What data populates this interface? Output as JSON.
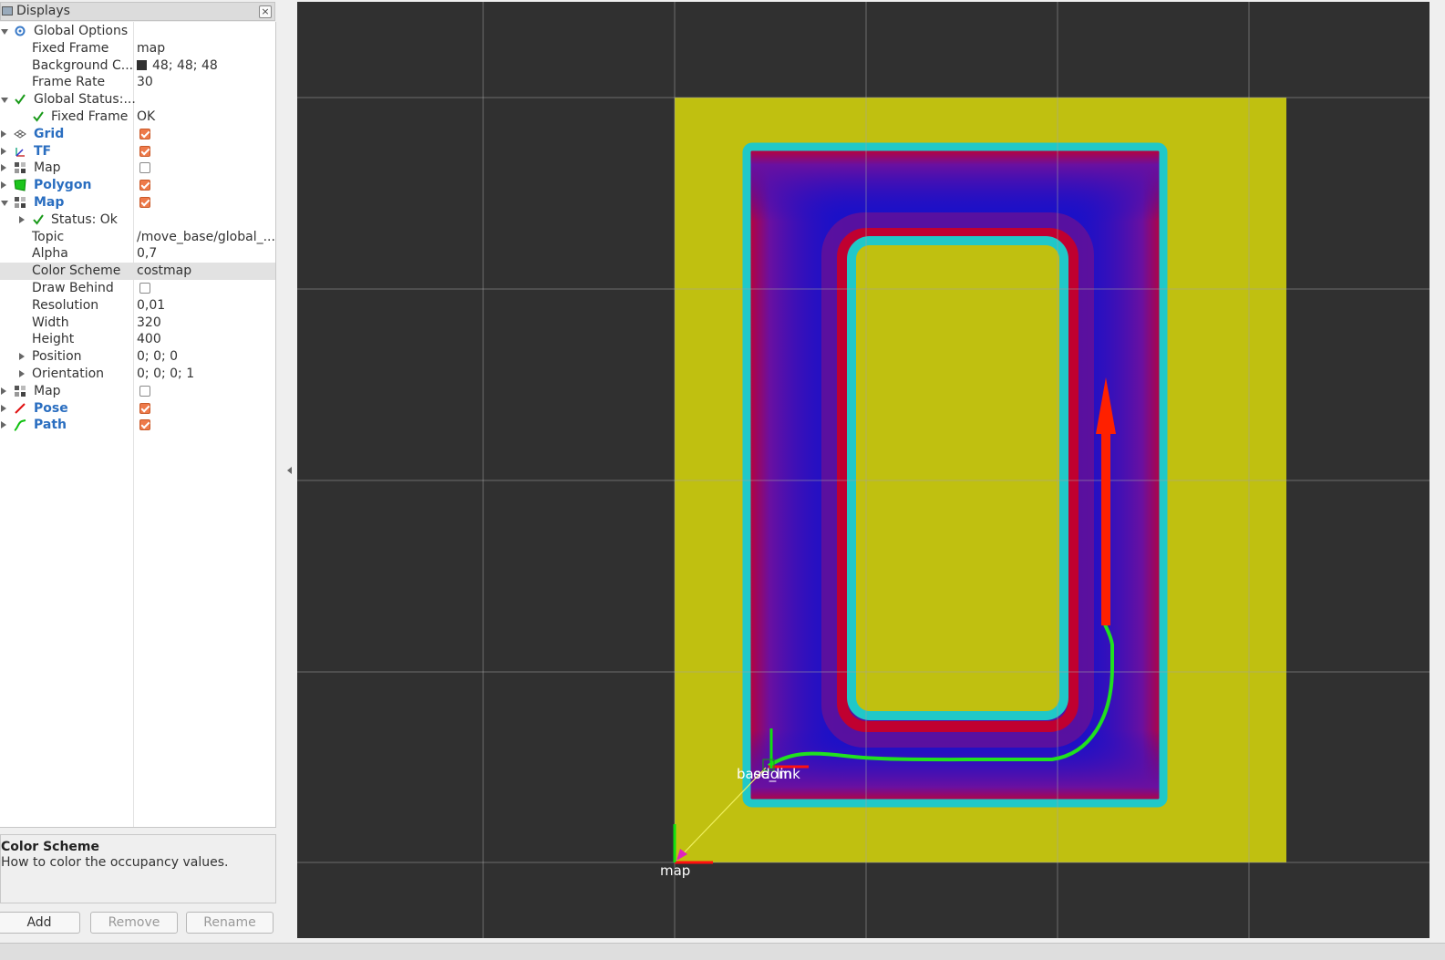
{
  "panel": {
    "title": "Displays",
    "close_glyph": "×"
  },
  "tree": [
    {
      "label": "Global Options",
      "indent": 0,
      "expander": "down",
      "icon": "gear-icon",
      "bold": false,
      "value": ""
    },
    {
      "label": "Fixed Frame",
      "indent": 1,
      "expander": "",
      "icon": "",
      "value": "map"
    },
    {
      "label": "Background C...",
      "indent": 1,
      "expander": "",
      "icon": "",
      "value": "48; 48; 48",
      "swatch": "#303030"
    },
    {
      "label": "Frame Rate",
      "indent": 1,
      "expander": "",
      "icon": "",
      "value": "30"
    },
    {
      "label": "Global Status:...",
      "indent": 0,
      "expander": "down",
      "icon": "check-icon",
      "value": ""
    },
    {
      "label": "Fixed Frame",
      "indent": 1,
      "expander": "",
      "icon": "check-icon",
      "value": "OK"
    },
    {
      "label": "Grid",
      "indent": 0,
      "expander": "right",
      "icon": "grid-icon",
      "bold": true,
      "checkbox": true
    },
    {
      "label": "TF",
      "indent": 0,
      "expander": "right",
      "icon": "tf-icon",
      "bold": true,
      "checkbox": true
    },
    {
      "label": "Map",
      "indent": 0,
      "expander": "right",
      "icon": "map-icon",
      "bold": false,
      "checkbox": false
    },
    {
      "label": "Polygon",
      "indent": 0,
      "expander": "right",
      "icon": "polygon-icon",
      "bold": true,
      "checkbox": true
    },
    {
      "label": "Map",
      "indent": 0,
      "expander": "down",
      "icon": "map-icon",
      "bold": true,
      "checkbox": true
    },
    {
      "label": "Status: Ok",
      "indent": 1,
      "expander": "right",
      "icon": "check-icon",
      "value": ""
    },
    {
      "label": "Topic",
      "indent": 1,
      "expander": "",
      "icon": "",
      "value": "/move_base/global_..."
    },
    {
      "label": "Alpha",
      "indent": 1,
      "expander": "",
      "icon": "",
      "value": "0,7"
    },
    {
      "label": "Color Scheme",
      "indent": 1,
      "expander": "",
      "icon": "",
      "value": "costmap",
      "selected": true
    },
    {
      "label": "Draw Behind",
      "indent": 1,
      "expander": "",
      "icon": "",
      "checkbox": false
    },
    {
      "label": "Resolution",
      "indent": 1,
      "expander": "",
      "icon": "",
      "value": "0,01"
    },
    {
      "label": "Width",
      "indent": 1,
      "expander": "",
      "icon": "",
      "value": "320"
    },
    {
      "label": "Height",
      "indent": 1,
      "expander": "",
      "icon": "",
      "value": "400"
    },
    {
      "label": "Position",
      "indent": 1,
      "expander": "right",
      "icon": "",
      "value": "0; 0; 0"
    },
    {
      "label": "Orientation",
      "indent": 1,
      "expander": "right",
      "icon": "",
      "value": "0; 0; 0; 1"
    },
    {
      "label": "Map",
      "indent": 0,
      "expander": "right",
      "icon": "map-icon",
      "bold": false,
      "checkbox": false
    },
    {
      "label": "Pose",
      "indent": 0,
      "expander": "right",
      "icon": "pose-icon",
      "bold": true,
      "checkbox": true
    },
    {
      "label": "Path",
      "indent": 0,
      "expander": "right",
      "icon": "path-icon",
      "bold": true,
      "checkbox": true
    }
  ],
  "description": {
    "title": "Color Scheme",
    "text": "How to color the occupancy values."
  },
  "buttons": {
    "add": "Add",
    "remove": "Remove",
    "rename": "Rename"
  },
  "viewport": {
    "background": "#303030",
    "frames": {
      "map": "map",
      "base_link": "base_link",
      "odom": "odom"
    },
    "colors": {
      "costmap_free": "#c0c010",
      "inflation": "#1010c8",
      "lethal": "#20c8c8",
      "path": "#20e020",
      "pose": "#ff2000"
    }
  }
}
